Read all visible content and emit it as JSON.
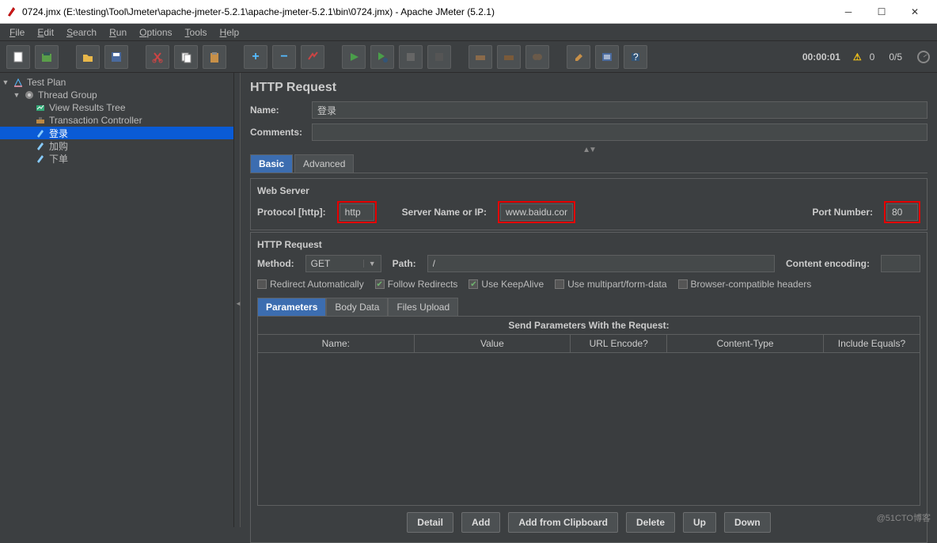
{
  "window": {
    "title": "0724.jmx (E:\\testing\\Tool\\Jmeter\\apache-jmeter-5.2.1\\apache-jmeter-5.2.1\\bin\\0724.jmx) - Apache JMeter (5.2.1)"
  },
  "menu": {
    "file": "File",
    "edit": "Edit",
    "search": "Search",
    "run": "Run",
    "options": "Options",
    "tools": "Tools",
    "help": "Help"
  },
  "status": {
    "timer": "00:00:01",
    "warnings": "0",
    "threads": "0/5"
  },
  "tree": {
    "testplan": "Test Plan",
    "threadgroup": "Thread Group",
    "viewresults": "View Results Tree",
    "txn": "Transaction Controller",
    "login": "登录",
    "add": "加购",
    "order": "下单"
  },
  "page": {
    "title": "HTTP Request",
    "name_label": "Name:",
    "name_value": "登录",
    "comments_label": "Comments:",
    "comments_value": "",
    "tab_basic": "Basic",
    "tab_advanced": "Advanced",
    "webserver_title": "Web Server",
    "protocol_label": "Protocol [http]:",
    "protocol_value": "http",
    "server_label": "Server Name or IP:",
    "server_value": "www.baidu.com",
    "port_label": "Port Number:",
    "port_value": "80",
    "httprequest_title": "HTTP Request",
    "method_label": "Method:",
    "method_value": "GET",
    "path_label": "Path:",
    "path_value": "/",
    "encoding_label": "Content encoding:",
    "encoding_value": "",
    "ck_redirect_auto": "Redirect Automatically",
    "ck_follow": "Follow Redirects",
    "ck_keepalive": "Use KeepAlive",
    "ck_multipart": "Use multipart/form-data",
    "ck_browser": "Browser-compatible headers",
    "subtab_params": "Parameters",
    "subtab_body": "Body Data",
    "subtab_files": "Files Upload",
    "params_header": "Send Parameters With the Request:",
    "col_name": "Name:",
    "col_value": "Value",
    "col_encode": "URL Encode?",
    "col_ctype": "Content-Type",
    "col_equals": "Include Equals?",
    "btn_detail": "Detail",
    "btn_add": "Add",
    "btn_clip": "Add from Clipboard",
    "btn_delete": "Delete",
    "btn_up": "Up",
    "btn_down": "Down"
  },
  "watermark": "@51CTO博客"
}
